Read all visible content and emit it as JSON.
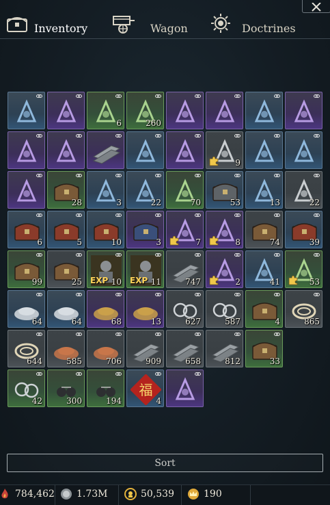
{
  "tabs": [
    {
      "label": "Inventory",
      "icon": "chest-icon",
      "active": true
    },
    {
      "label": "Wagon",
      "icon": "wagon-icon",
      "active": false
    },
    {
      "label": "Doctrines",
      "icon": "doctrine-sun-icon",
      "active": false
    }
  ],
  "sort_label": "Sort",
  "currencies": [
    {
      "icon": "fame-icon",
      "value": "784,462"
    },
    {
      "icon": "silver-icon",
      "value": "1.73M"
    },
    {
      "icon": "laurel-gold-icon",
      "value": "50,539"
    },
    {
      "icon": "crown-icon",
      "value": "190"
    }
  ],
  "colors": {
    "blue": "#325575",
    "purple": "#4c3680",
    "green": "#3e6e3d",
    "grey": "#4c5257",
    "exp": "#ffd35a"
  },
  "rows": [
    [
      {
        "name": "bow-icon",
        "q": "blue",
        "count": ""
      },
      {
        "name": "crossbow-icon",
        "q": "purple",
        "count": ""
      },
      {
        "name": "war-horn-icon",
        "q": "green",
        "count": "6"
      },
      {
        "name": "tooth-horn-icon",
        "q": "green",
        "count": "260"
      },
      {
        "name": "musket-icon",
        "q": "purple",
        "count": ""
      },
      {
        "name": "great-helm-icon",
        "q": "purple",
        "count": ""
      },
      {
        "name": "sword-icon",
        "q": "blue",
        "count": ""
      },
      {
        "name": "falchion-icon",
        "q": "purple",
        "count": ""
      }
    ],
    [
      {
        "name": "kettle-helm-icon",
        "q": "purple",
        "count": ""
      },
      {
        "name": "hood-icon",
        "q": "purple",
        "count": ""
      },
      {
        "name": "plate-armor-icon",
        "q": "purple",
        "count": ""
      },
      {
        "name": "gambeson-icon",
        "q": "blue",
        "count": ""
      },
      {
        "name": "gauntlet-icon",
        "q": "purple",
        "count": ""
      },
      {
        "name": "scroll-bundle-icon",
        "q": "grey",
        "count": "9",
        "puzzle": true
      },
      {
        "name": "leather-glove-icon",
        "q": "blue",
        "count": ""
      },
      {
        "name": "boots-icon",
        "q": "blue",
        "count": ""
      }
    ],
    [
      {
        "name": "greaves-icon",
        "q": "purple",
        "count": ""
      },
      {
        "name": "wooden-chest-icon",
        "q": "green",
        "count": "28"
      },
      {
        "name": "firework-icon",
        "q": "blue",
        "count": "3"
      },
      {
        "name": "festive-banner-icon",
        "q": "blue",
        "count": "22"
      },
      {
        "name": "round-shield-icon",
        "q": "green",
        "count": "70"
      },
      {
        "name": "iron-chest-icon",
        "q": "blue",
        "count": "53"
      },
      {
        "name": "candy-cane-icon",
        "q": "blue",
        "count": "13"
      },
      {
        "name": "silver-ore-icon",
        "q": "grey",
        "count": "22"
      }
    ],
    [
      {
        "name": "red-chest-icon",
        "q": "blue",
        "count": "6"
      },
      {
        "name": "red-chest-icon",
        "q": "blue",
        "count": "5"
      },
      {
        "name": "red-chest-icon",
        "q": "blue",
        "count": "10"
      },
      {
        "name": "blue-chest-icon",
        "q": "purple",
        "count": "3"
      },
      {
        "name": "cannon-icon",
        "q": "purple",
        "count": "7",
        "puzzle": true
      },
      {
        "name": "siege-engine-icon",
        "q": "purple",
        "count": "8",
        "puzzle": true
      },
      {
        "name": "wooden-chest-icon",
        "q": "grey",
        "count": "74"
      },
      {
        "name": "red-chest-icon",
        "q": "blue",
        "count": "39"
      }
    ],
    [
      {
        "name": "wooden-chest-icon",
        "q": "green",
        "count": "99"
      },
      {
        "name": "wooden-chest-icon",
        "q": "grey",
        "count": "25"
      },
      {
        "name": "knights-exp-icon",
        "q": "green",
        "count": "10",
        "exp": "EXP"
      },
      {
        "name": "knight-exp-icon",
        "q": "green",
        "count": "11",
        "exp": "EXP"
      },
      {
        "name": "iron-ingot-icon",
        "q": "grey",
        "count": "747"
      },
      {
        "name": "grenade-sack-icon",
        "q": "purple",
        "count": "2",
        "puzzle": true
      },
      {
        "name": "golden-key-icon",
        "q": "blue",
        "count": "41"
      },
      {
        "name": "compass-emblem-icon",
        "q": "green",
        "count": "53",
        "puzzle": true
      }
    ],
    [
      {
        "name": "silver-dust-icon",
        "q": "blue",
        "count": "64"
      },
      {
        "name": "silver-dust-icon",
        "q": "blue",
        "count": "64"
      },
      {
        "name": "gold-dust-icon",
        "q": "purple",
        "count": "68"
      },
      {
        "name": "gold-dust-icon",
        "q": "purple",
        "count": "13"
      },
      {
        "name": "iron-rings-icon",
        "q": "grey",
        "count": "627"
      },
      {
        "name": "iron-rings-icon",
        "q": "grey",
        "count": "587"
      },
      {
        "name": "wooden-chest-icon",
        "q": "green",
        "count": "4"
      },
      {
        "name": "rope-icon",
        "q": "grey",
        "count": "865"
      }
    ],
    [
      {
        "name": "rope-icon",
        "q": "grey",
        "count": "644"
      },
      {
        "name": "copper-dust-icon",
        "q": "grey",
        "count": "585"
      },
      {
        "name": "copper-dust-icon",
        "q": "grey",
        "count": "706"
      },
      {
        "name": "iron-bar-icon",
        "q": "grey",
        "count": "909"
      },
      {
        "name": "steel-plate-icon",
        "q": "grey",
        "count": "658"
      },
      {
        "name": "steel-plate-icon",
        "q": "grey",
        "count": "812"
      },
      {
        "name": "wooden-chest-icon",
        "q": "green",
        "count": "33"
      }
    ],
    [
      {
        "name": "scroll-rings-icon",
        "q": "green",
        "count": "42"
      },
      {
        "name": "iron-balls-icon",
        "q": "green",
        "count": "300"
      },
      {
        "name": "iron-balls-icon",
        "q": "green",
        "count": "194"
      },
      {
        "name": "fortune-token-icon",
        "q": "blue",
        "count": "4",
        "glyph": "福"
      },
      {
        "name": "banner-seal-icon",
        "q": "purple",
        "count": ""
      }
    ]
  ]
}
